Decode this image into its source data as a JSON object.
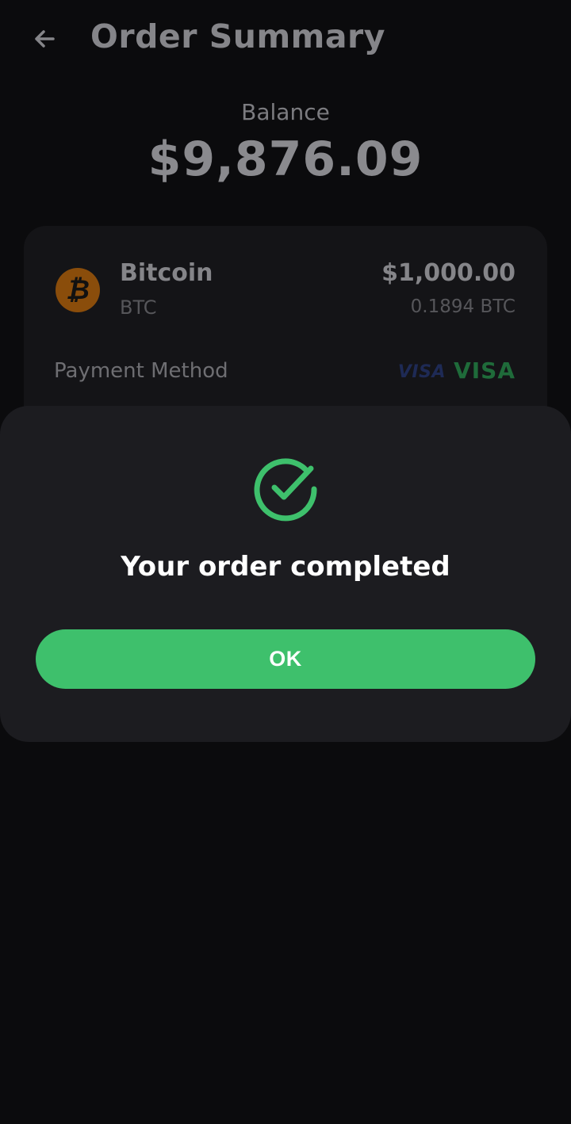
{
  "header": {
    "title": "Order Summary",
    "back_icon": "arrow-left-icon"
  },
  "balance": {
    "label": "Balance",
    "value": "$9,876.09"
  },
  "order": {
    "coin_icon": "bitcoin-icon",
    "coin_symbol": "₿",
    "coin_name": "Bitcoin",
    "coin_ticker": "BTC",
    "amount": "$1,000.00",
    "quantity": "0.1894 BTC",
    "payment_label": "Payment Method",
    "payment_logo": "VISA",
    "payment_text": "VISA"
  },
  "modal": {
    "icon": "check-circle-icon",
    "message": "Your order completed",
    "ok_label": "OK"
  },
  "colors": {
    "background": "#0b0b0d",
    "card": "#141417",
    "modal": "#1c1c20",
    "accent_green": "#3ec06c",
    "bitcoin_orange": "#8a4d0b"
  }
}
